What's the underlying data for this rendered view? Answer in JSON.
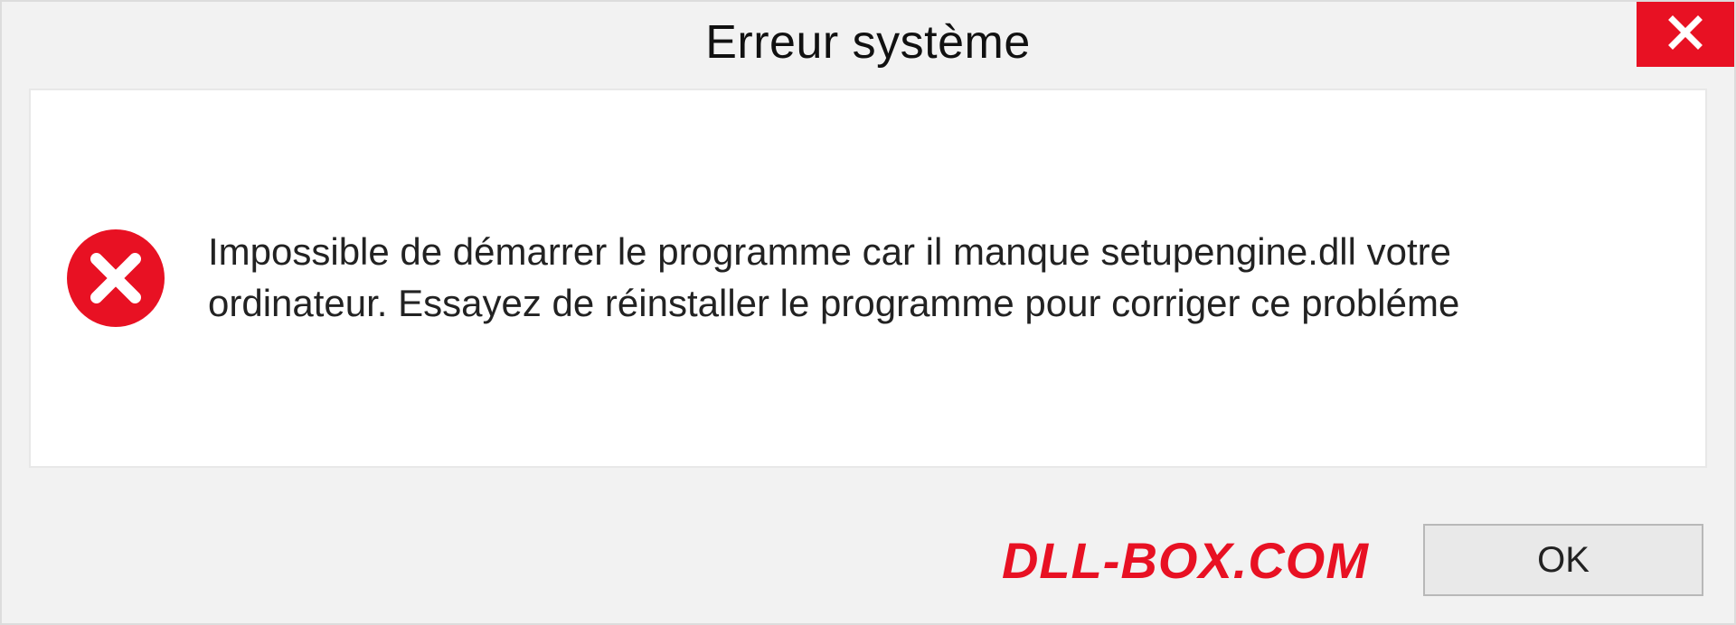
{
  "titlebar": {
    "title": "Erreur système"
  },
  "content": {
    "message": "Impossible de démarrer le programme car il manque setupengine.dll votre ordinateur. Essayez de réinstaller le programme pour corriger ce probléme"
  },
  "footer": {
    "watermark": "DLL-BOX.COM",
    "ok_label": "OK"
  },
  "colors": {
    "error_red": "#e81123",
    "panel_bg": "#f2f2f2"
  }
}
